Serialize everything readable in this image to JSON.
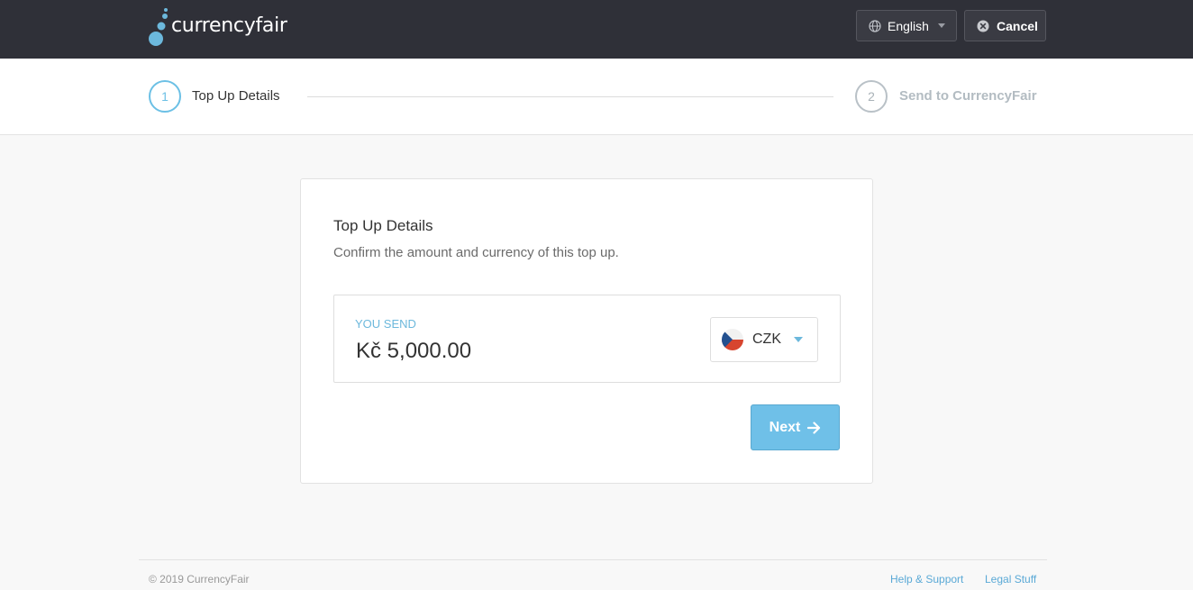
{
  "header": {
    "brand": "currencyfair",
    "language_label": "English",
    "cancel_label": "Cancel"
  },
  "stepper": {
    "steps": [
      {
        "number": "1",
        "label": "Top Up Details",
        "state": "active"
      },
      {
        "number": "2",
        "label": "Send to CurrencyFair",
        "state": "inactive"
      }
    ]
  },
  "card": {
    "title": "Top Up Details",
    "subtitle": "Confirm the amount and currency of this top up.",
    "send": {
      "label": "YOU SEND",
      "amount": "Kč 5,000.00",
      "currency_code": "CZK"
    },
    "next_label": "Next"
  },
  "footer": {
    "copyright": "© 2019 CurrencyFair",
    "links": [
      "Help & Support",
      "Legal Stuff"
    ]
  },
  "colors": {
    "header_bg": "#2f3038",
    "accent": "#6cc0e5",
    "next_button": "#6fc0e8"
  },
  "icons": {
    "language": "globe-icon",
    "cancel": "close-circle-icon",
    "next": "arrow-right-icon",
    "currency": "czech-flag-icon"
  }
}
